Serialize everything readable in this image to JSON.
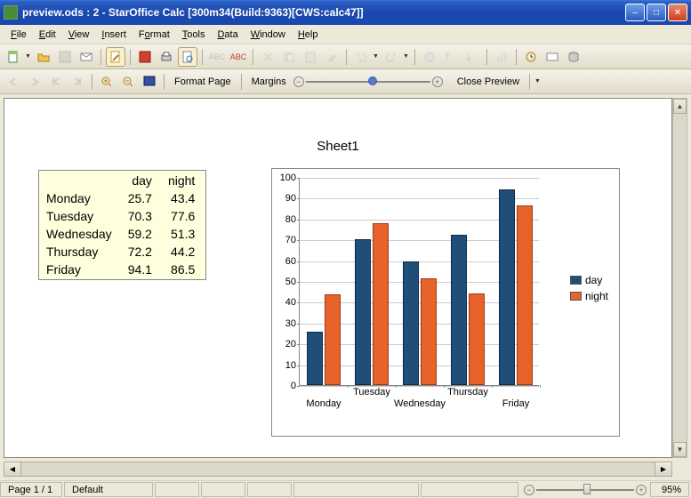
{
  "window": {
    "title": "preview.ods : 2 - StarOffice Calc [300m34(Build:9363)[CWS:calc47]]"
  },
  "menu": [
    "File",
    "Edit",
    "View",
    "Insert",
    "Format",
    "Tools",
    "Data",
    "Window",
    "Help"
  ],
  "toolbar2": {
    "format_page": "Format Page",
    "margins": "Margins",
    "close_preview": "Close Preview"
  },
  "preview": {
    "sheet_title": "Sheet1",
    "table": {
      "headers": [
        "",
        "day",
        "night"
      ],
      "rows": [
        {
          "label": "Monday",
          "day": "25.7",
          "night": "43.4"
        },
        {
          "label": "Tuesday",
          "day": "70.3",
          "night": "77.6"
        },
        {
          "label": "Wednesday",
          "day": "59.2",
          "night": "51.3"
        },
        {
          "label": "Thursday",
          "day": "72.2",
          "night": "44.2"
        },
        {
          "label": "Friday",
          "day": "94.1",
          "night": "86.5"
        }
      ]
    }
  },
  "chart_data": {
    "type": "bar",
    "categories": [
      "Monday",
      "Tuesday",
      "Wednesday",
      "Thursday",
      "Friday"
    ],
    "series": [
      {
        "name": "day",
        "values": [
          25.7,
          70.3,
          59.2,
          72.2,
          94.1
        ],
        "color": "#1f4e79"
      },
      {
        "name": "night",
        "values": [
          43.4,
          77.6,
          51.3,
          44.2,
          86.5
        ],
        "color": "#e8632c"
      }
    ],
    "ylim": [
      0,
      100
    ],
    "y_ticks": [
      0,
      10,
      20,
      30,
      40,
      50,
      60,
      70,
      80,
      90,
      100
    ],
    "xlabel": "",
    "ylabel": "",
    "title": "",
    "x_label_rows": [
      [
        "",
        "Tuesday",
        "",
        "Thursday",
        ""
      ],
      [
        "Monday",
        "",
        "Wednesday",
        "",
        "Friday"
      ]
    ]
  },
  "status": {
    "page": "Page 1 / 1",
    "style": "Default",
    "zoom": "95%"
  }
}
